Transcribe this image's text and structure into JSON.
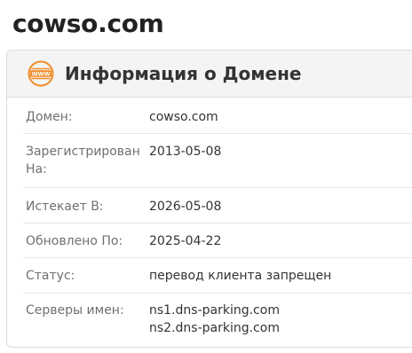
{
  "page": {
    "title": "cowso.com"
  },
  "card": {
    "title": "Информация о Домене",
    "icon": "www-globe-icon",
    "accent_color": "#f08c28"
  },
  "rows": [
    {
      "label": "Домен:",
      "value": "cowso.com"
    },
    {
      "label": "Зарегистрирован На:",
      "value": "2013-05-08"
    },
    {
      "label": "Истекает В:",
      "value": "2026-05-08"
    },
    {
      "label": "Обновлено По:",
      "value": "2025-04-22"
    },
    {
      "label": "Статус:",
      "value": "перевод клиента запрещен"
    },
    {
      "label": "Серверы имен:",
      "values": [
        "ns1.dns-parking.com",
        "ns2.dns-parking.com"
      ]
    }
  ]
}
